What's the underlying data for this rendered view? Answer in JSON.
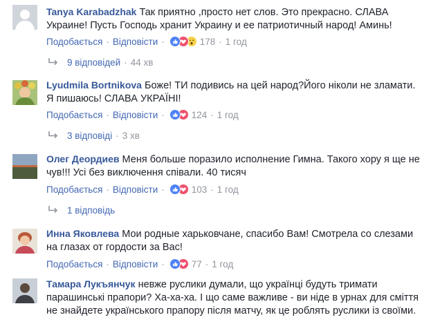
{
  "colors": {
    "link": "#4267b2",
    "author": "#365899",
    "meta": "#90949c",
    "text": "#1d2129",
    "like": "#4e82f5",
    "love": "#f0506e",
    "wow": "#f7d24b"
  },
  "comments": [
    {
      "author": "Tanya Karabadzhak",
      "text": "Так приятно ,просто нет слов. Это прекрасно. СЛАВА Украине! Пусть Господь хранит Украину и ее патриотичный народ! Аминь!",
      "like_label": "Подобається",
      "reply_label": "Відповісти",
      "reactions": [
        "like-icon",
        "love-icon",
        "wow-icon"
      ],
      "reaction_count": "178",
      "time": "1 год",
      "replies_text": "9 відповідей",
      "replies_time": "44 хв"
    },
    {
      "author": "Lyudmila Bortnikova",
      "text": "Боже! ТИ подивись на цей народ?Його ніколи не зламати. Я пишаюсь! СЛАВА УКРАЇНІ!",
      "like_label": "Подобається",
      "reply_label": "Відповісти",
      "reactions": [
        "like-icon",
        "love-icon"
      ],
      "reaction_count": "124",
      "time": "1 год",
      "replies_text": "3 відповіді",
      "replies_time": "3 хв"
    },
    {
      "author": "Олег Деордиев",
      "text": "Меня больше поразило исполнение Гимна. Такого хору я ще не чув!!! Усі без виключення співали. 40 тисяч",
      "like_label": "Подобається",
      "reply_label": "Відповісти",
      "reactions": [
        "like-icon",
        "love-icon"
      ],
      "reaction_count": "103",
      "time": "1 год",
      "replies_text": "1 відповідь",
      "replies_time": ""
    },
    {
      "author": "Инна Яковлева",
      "text": "Мои родные харьковчане, спасибо Вам! Смотрела со слезами на глазах от гордости за Вас!",
      "like_label": "Подобається",
      "reply_label": "Відповісти",
      "reactions": [
        "like-icon",
        "love-icon"
      ],
      "reaction_count": "77",
      "time": "1 год"
    },
    {
      "author": "Тамара Лукъянчук",
      "text": "невже руслики думали, що українці будуть тримати парашинські прапори? Ха-ха-ха. І що саме важливе - ви ніде в урнах для сміття не знайдете українського прапору після матчу, як це роблять руслики із своїми."
    }
  ]
}
